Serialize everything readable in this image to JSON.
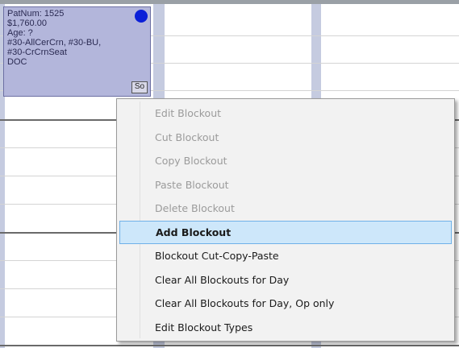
{
  "appointment": {
    "patnum": "PatNum: 1525",
    "amount": "$1,760.00",
    "age": "Age: ?",
    "procedures_line1": "#30-AllCerCrn, #30-BU,",
    "procedures_line2": "#30-CrCrnSeat",
    "provider": "DOC",
    "so_label": "So",
    "status_dot_color": "#0a1fd8",
    "block_color": "#b3b6db"
  },
  "context_menu": {
    "items": [
      {
        "label": "Edit Blockout",
        "enabled": false
      },
      {
        "label": "Cut Blockout",
        "enabled": false
      },
      {
        "label": "Copy Blockout",
        "enabled": false
      },
      {
        "label": "Paste Blockout",
        "enabled": false
      },
      {
        "label": "Delete Blockout",
        "enabled": false
      },
      {
        "label": "Add Blockout",
        "enabled": true,
        "highlighted": true
      },
      {
        "label": "Blockout Cut-Copy-Paste",
        "enabled": true
      },
      {
        "label": "Clear All Blockouts for Day",
        "enabled": true
      },
      {
        "label": "Clear All Blockouts for Day, Op only",
        "enabled": true
      },
      {
        "label": "Edit Blockout Types",
        "enabled": true
      }
    ],
    "highlight_color": "#cde7fa"
  }
}
